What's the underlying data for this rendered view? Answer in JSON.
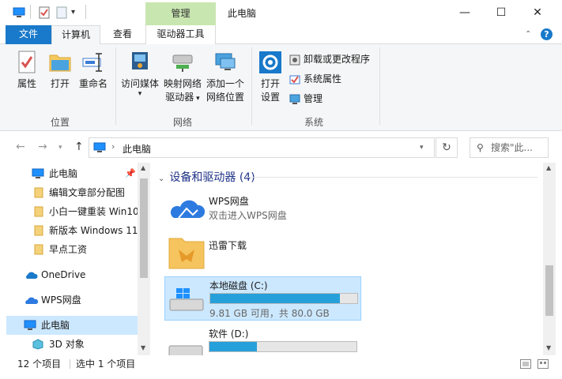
{
  "window": {
    "title": "此电脑",
    "context_tab_group": "管理",
    "controls": {
      "minimize": "—",
      "maximize": "☐",
      "close": "✕"
    }
  },
  "tabs": {
    "file": "文件",
    "computer": "计算机",
    "view": "查看",
    "drive_tools": "驱动器工具"
  },
  "ribbon": {
    "location_group": {
      "label": "位置",
      "properties": "属性",
      "open": "打开",
      "rename": "重命名"
    },
    "network_group": {
      "label": "网络",
      "access_media_line1": "访问媒体",
      "map_drive_line1": "映射网络",
      "map_drive_line2": "驱动器",
      "add_location_line1": "添加一个",
      "add_location_line2": "网络位置"
    },
    "system_group": {
      "label": "系统",
      "open_settings_line1": "打开",
      "open_settings_line2": "设置",
      "uninstall": "卸载或更改程序",
      "system_properties": "系统属性",
      "manage": "管理"
    }
  },
  "address": {
    "path": "此电脑",
    "search_placeholder": "搜索\"此..."
  },
  "nav": {
    "items": [
      {
        "label": "此电脑",
        "pinned": true
      },
      {
        "label": "编辑文章部分配图"
      },
      {
        "label": "小白一键重装 Win10"
      },
      {
        "label": "新版本 Windows 11"
      },
      {
        "label": "早点工资"
      },
      {
        "label": "OneDrive"
      },
      {
        "label": "WPS网盘"
      },
      {
        "label": "此电脑",
        "selected": true
      },
      {
        "label": "3D 对象"
      }
    ]
  },
  "content": {
    "group_title": "设备和驱动器 (4)",
    "drives": [
      {
        "name": "WPS网盘",
        "subtitle": "双击进入WPS网盘"
      },
      {
        "name": "迅雷下载"
      },
      {
        "name": "本地磁盘 (C:)",
        "usage": "9.81 GB 可用，共 80.0 GB",
        "used_fraction": 0.88,
        "selected": true
      },
      {
        "name": "软件 (D:)",
        "used_fraction": 0.32
      }
    ]
  },
  "status": {
    "count": "12 个项目",
    "selection": "选中 1 个项目"
  },
  "colors": {
    "accent": "#1979ca",
    "context_tab": "#c8e6b0",
    "selection": "#cce8ff",
    "bar": "#26a0da"
  }
}
